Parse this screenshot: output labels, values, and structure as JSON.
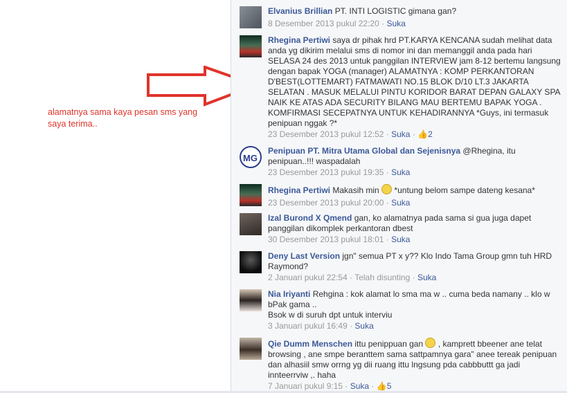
{
  "annotation_text": "alamatnya  sama kaya pesan sms yang saya terima..",
  "like_label": "Suka",
  "comments": [
    {
      "author": "Elvanius Brillian",
      "text": "PT. INTI LOGISTIC gimana gan?",
      "time": "8 Desember 2013 pukul 22:20",
      "likes": ""
    },
    {
      "author": "Rhegina Pertiwi",
      "text": "saya dr pihak hrd PT.KARYA KENCANA sudah melihat data anda yg dikirim melalui sms di nomor ini dan memanggil anda pada hari SELASA 24 des 2013 untuk panggilan INTERVIEW jam 8-12 bertemu langsung dengan bapak YOGA (manager) ALAMATNYA : KOMP PERKANTORAN D'BEST(LOTTEMART) FATMAWATI NO.15 BLOK D/10 LT.3 JAKARTA SELATAN . MASUK MELALUI PINTU KORIDOR BARAT DEPAN GALAXY SPA NAIK KE ATAS ADA SECURITY BILANG MAU BERTEMU BAPAK YOGA . KOMFIRMASI SECEPATNYA UNTUK KEHADIRANNYA *Guys, ini termasuk penipuan nggak ?*",
      "time": "23 Desember 2013 pukul 12:52",
      "likes": "2"
    },
    {
      "author": "Penipuan PT. Mitra Utama Global dan Sejenisnya",
      "text": "@Rhegina, itu penipuan..!!! waspadalah",
      "time": "23 Desember 2013 pukul 19:35",
      "likes": ""
    },
    {
      "author": "Rhegina Pertiwi",
      "text": "Makasih min",
      "text_after": "*untung belom sampe dateng kesana*",
      "time": "23 Desember 2013 pukul 20:00",
      "likes": ""
    },
    {
      "author": "Izal Burond X Qmend",
      "text": "gan, ko alamatnya pada sama si gua juga dapet panggilan dikomplek perkantoran dbest",
      "time": "30 Desember 2013 pukul 18:01",
      "likes": ""
    },
    {
      "author": "Deny Last Version",
      "text": "jgn\" semua PT x y?? Klo Indo Tama Group gmn tuh HRD Raymond?",
      "time": "2 Januari pukul 22:54",
      "extra": "Telah disunting",
      "likes": ""
    },
    {
      "author": "Nia Iriyanti",
      "text": "Rehgina : kok alamat lo sma ma w .. cuma beda namany .. klo w bPak gama ..",
      "text2": "Bsok w di suruh dpt untuk interviu",
      "time": "3 Januari pukul 16:49",
      "likes": ""
    },
    {
      "author": "Qie Dumm Menschen",
      "text": "ittu penippuan gan",
      "text_after": ", kamprett bbeener ane telat browsing , ane smpe beranttem sama sattpamnya gara\" anee tereak penipuan dan alhasiil smw orrng yg dii ruang ittu lngsung pda cabbbuttt ga jadi innteerrviw ,. haha",
      "time": "7 Januari pukul 9:15",
      "likes": "5"
    }
  ]
}
